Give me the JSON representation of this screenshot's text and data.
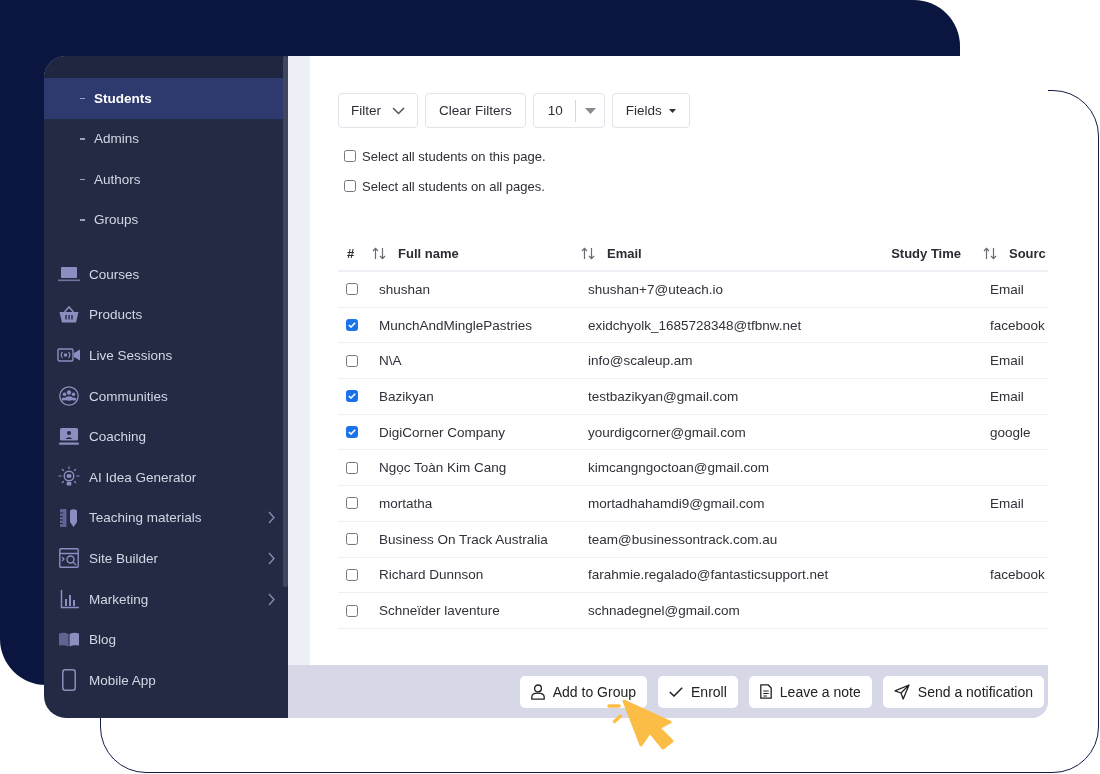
{
  "sidebar": {
    "items": [
      {
        "kind": "sub",
        "label": "Students",
        "selected": true
      },
      {
        "kind": "sub",
        "label": "Admins",
        "selected": false
      },
      {
        "kind": "sub",
        "label": "Authors",
        "selected": false
      },
      {
        "kind": "sub",
        "label": "Groups",
        "selected": false
      },
      {
        "kind": "main",
        "label": "Courses",
        "selected": false,
        "has_submenu": false
      },
      {
        "kind": "main",
        "label": "Products",
        "selected": false,
        "has_submenu": false
      },
      {
        "kind": "main",
        "label": "Live Sessions",
        "selected": false,
        "has_submenu": false
      },
      {
        "kind": "main",
        "label": "Communities",
        "selected": false,
        "has_submenu": false
      },
      {
        "kind": "main",
        "label": "Coaching",
        "selected": false,
        "has_submenu": false
      },
      {
        "kind": "main",
        "label": "AI Idea Generator",
        "selected": false,
        "has_submenu": false
      },
      {
        "kind": "main",
        "label": "Teaching materials",
        "selected": false,
        "has_submenu": true
      },
      {
        "kind": "main",
        "label": "Site Builder",
        "selected": false,
        "has_submenu": true
      },
      {
        "kind": "main",
        "label": "Marketing",
        "selected": false,
        "has_submenu": true
      },
      {
        "kind": "main",
        "label": "Blog",
        "selected": false,
        "has_submenu": false
      },
      {
        "kind": "main",
        "label": "Mobile App",
        "selected": false,
        "has_submenu": false
      }
    ]
  },
  "toolbar": {
    "filter": "Filter",
    "clear_filters": "Clear Filters",
    "page_size": "10",
    "fields": "Fields"
  },
  "bulk_select": [
    {
      "label": "Select all students on this page.",
      "checked": false
    },
    {
      "label": "Select all students on all pages.",
      "checked": false
    }
  ],
  "table": {
    "columns": [
      {
        "label": "#",
        "sortable": false
      },
      {
        "label": "Full name",
        "sortable": true
      },
      {
        "label": "Email",
        "sortable": true
      },
      {
        "label": "Study Time",
        "sortable": false
      },
      {
        "label": "Sourc",
        "sortable": true
      }
    ],
    "rows": [
      {
        "checked": false,
        "full_name": "shushan",
        "email": "shushan+7@uteach.io",
        "source": "Email"
      },
      {
        "checked": true,
        "full_name": "MunchAndMinglePastries",
        "email": "exidchyolk_1685728348@tfbnw.net",
        "source": "facebook"
      },
      {
        "checked": false,
        "full_name": "N\\A",
        "email": "info@scaleup.am",
        "source": "Email"
      },
      {
        "checked": true,
        "full_name": "Bazikyan",
        "email": "testbazikyan@gmail.com",
        "source": "Email"
      },
      {
        "checked": true,
        "full_name": "DigiCorner Company",
        "email": "yourdigcorner@gmail.com",
        "source": "google"
      },
      {
        "checked": false,
        "full_name": "Ngọc Toàn Kim Cang",
        "email": "kimcangngoctoan@gmail.com"
      },
      {
        "checked": false,
        "full_name": "mortatha",
        "email": "mortadhahamdi9@gmail.com",
        "source": "Email"
      },
      {
        "checked": false,
        "full_name": "Business On Track Australia",
        "email": "team@businessontrack.com.au"
      },
      {
        "checked": false,
        "full_name": "Richard Dunnson",
        "email": "farahmie.regalado@fantasticsupport.net",
        "source": "facebook"
      },
      {
        "checked": false,
        "full_name": "Schneïder laventure",
        "email": "schnadegnel@gmail.com"
      }
    ]
  },
  "bulk_actions": [
    "Add to Group",
    "Enroll",
    "Leave a note",
    "Send a notification"
  ]
}
